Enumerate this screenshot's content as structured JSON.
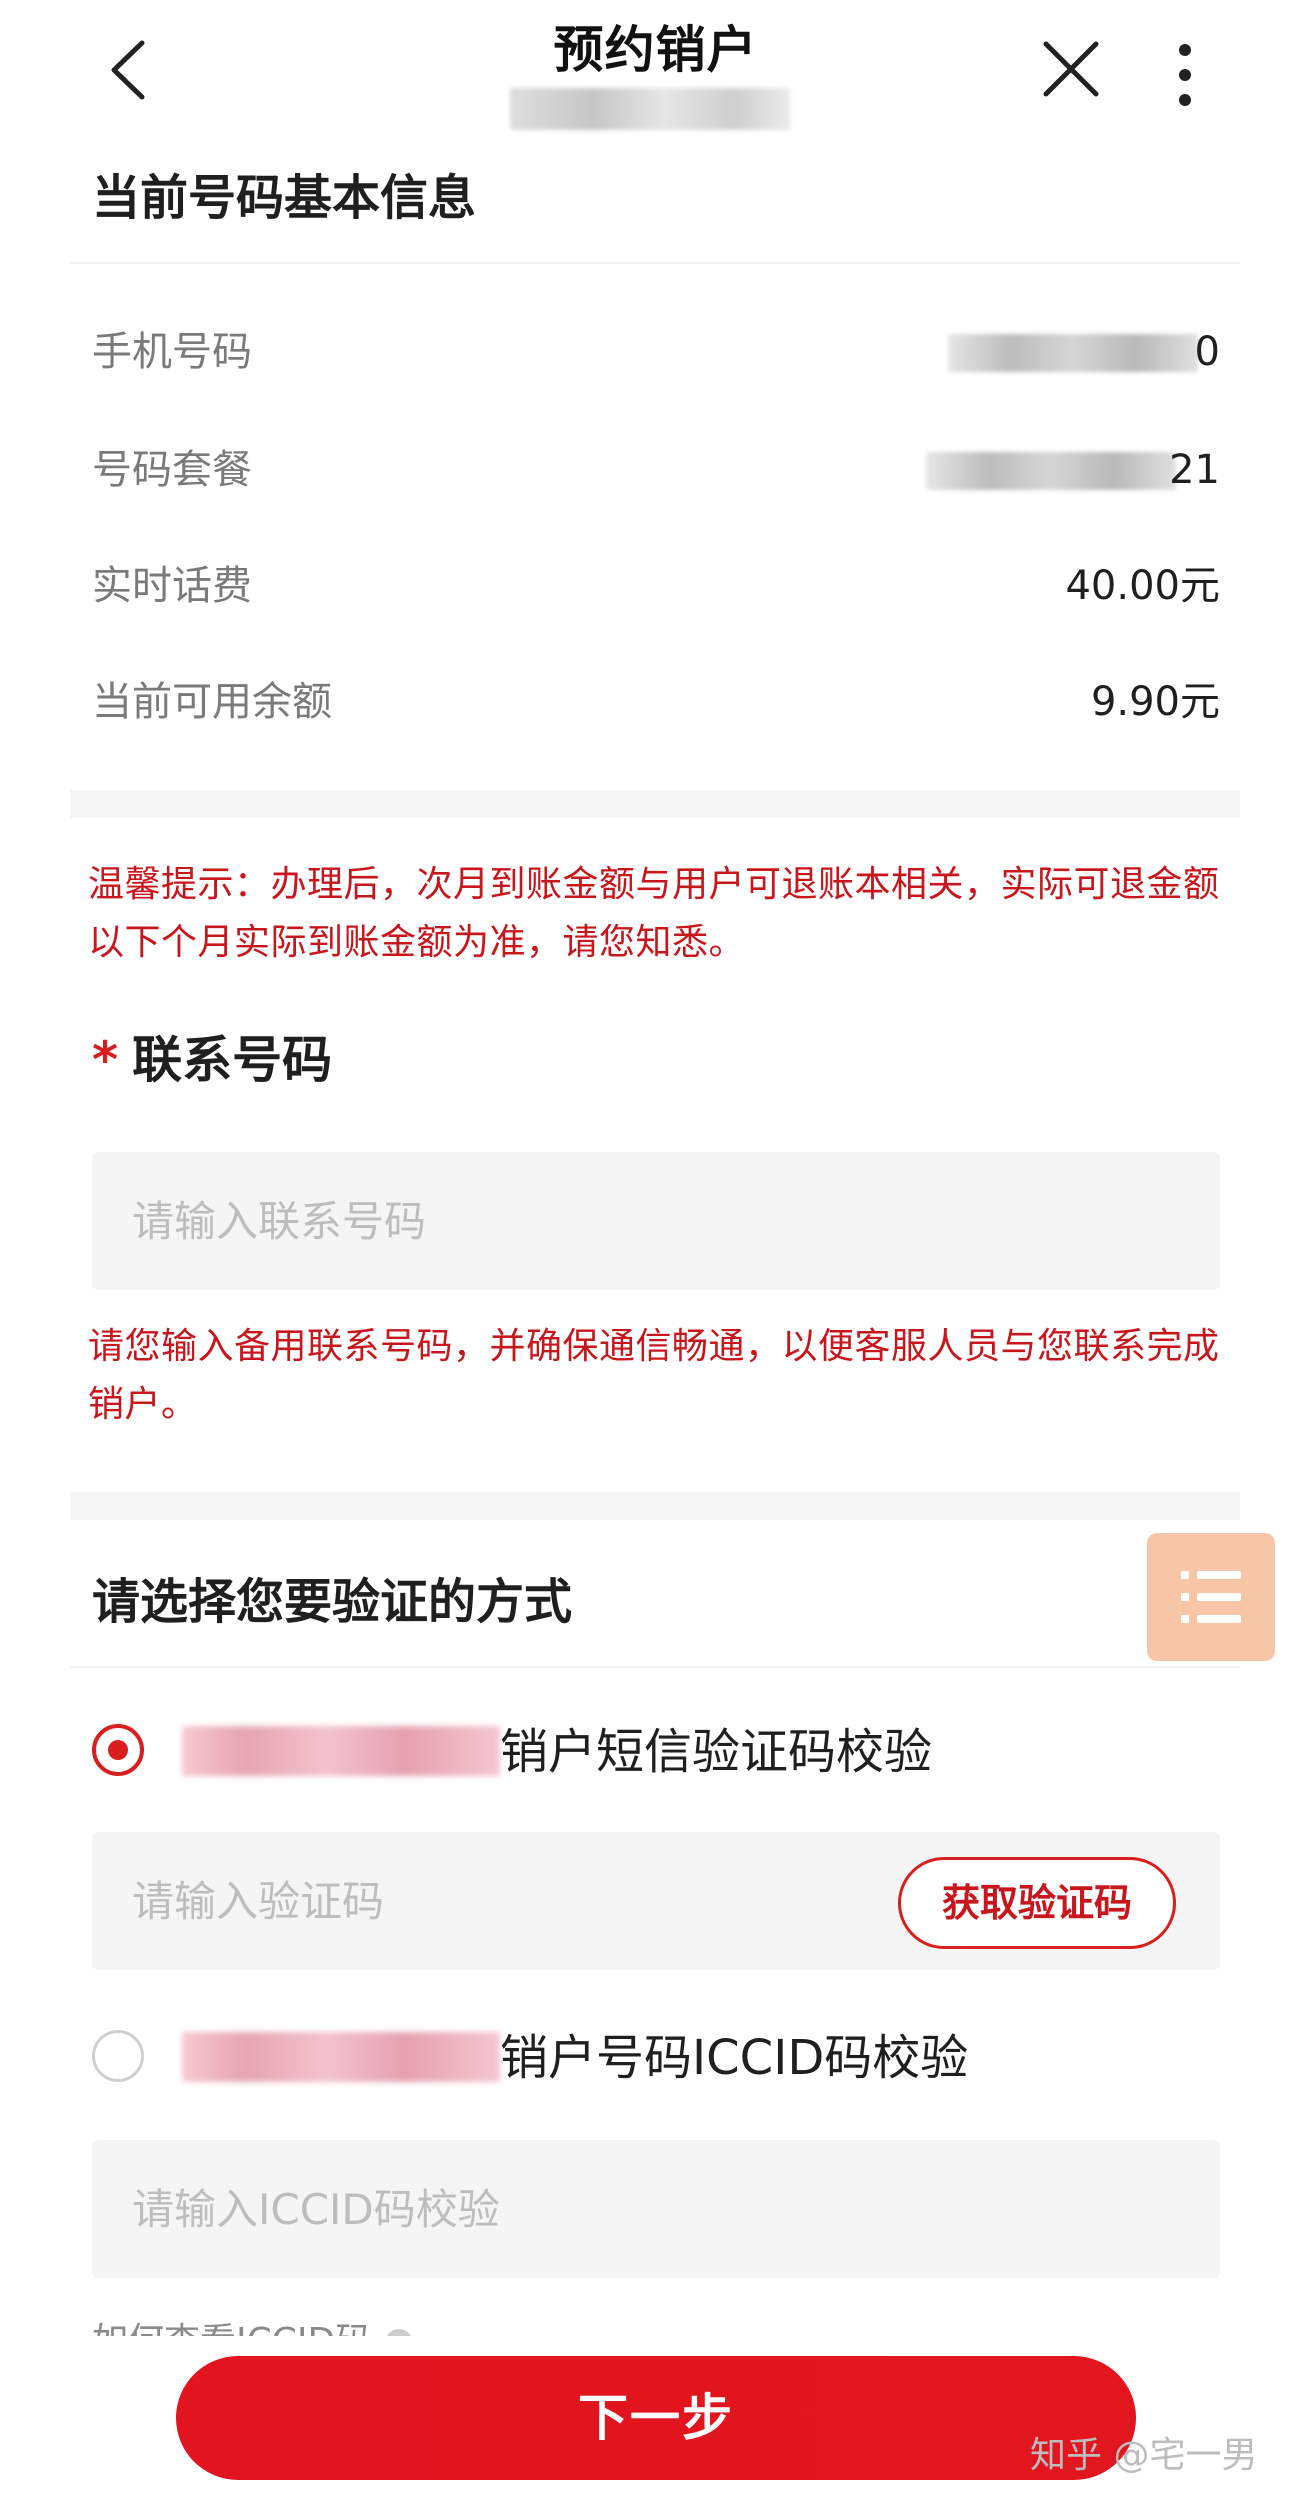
{
  "header": {
    "title": "预约销户"
  },
  "basic_info": {
    "title": "当前号码基本信息",
    "rows": [
      {
        "label": "手机号码",
        "value": "0"
      },
      {
        "label": "号码套餐",
        "value": "21"
      },
      {
        "label": "实时话费",
        "value": "40.00元"
      },
      {
        "label": "当前可用余额",
        "value": "9.90元"
      }
    ]
  },
  "tip_refund": "温馨提示：办理后，次月到账金额与用户可退账本相关，实际可退金额以下个月实际到账金额为准，请您知悉。",
  "contact": {
    "required_mark": "*",
    "label": "联系号码",
    "placeholder": "请输入联系号码",
    "note": "请您输入备用联系号码，并确保通信畅通，以便客服人员与您联系完成销户。"
  },
  "verify": {
    "title": "请选择您要验证的方式",
    "options": [
      {
        "text": "销户短信验证码校验",
        "selected": true,
        "input_placeholder": "请输入验证码",
        "button_label": "获取验证码"
      },
      {
        "text": "销户号码ICCID码校验",
        "selected": false,
        "input_placeholder": "请输入ICCID码校验"
      }
    ],
    "help_link": "如何查看ICCID码"
  },
  "footer": {
    "next_label": "下一步",
    "watermark": "知乎 @宅一男"
  },
  "icons": {
    "back": "chevron-left-icon",
    "close": "close-icon",
    "more": "more-vertical-icon",
    "menu": "list-menu-icon",
    "help": "question-circle-icon"
  },
  "colors": {
    "accent": "#e2141f",
    "warning_text": "#c8161d",
    "float_menu_bg": "#f6c6a6",
    "input_bg": "#f5f5f5"
  }
}
